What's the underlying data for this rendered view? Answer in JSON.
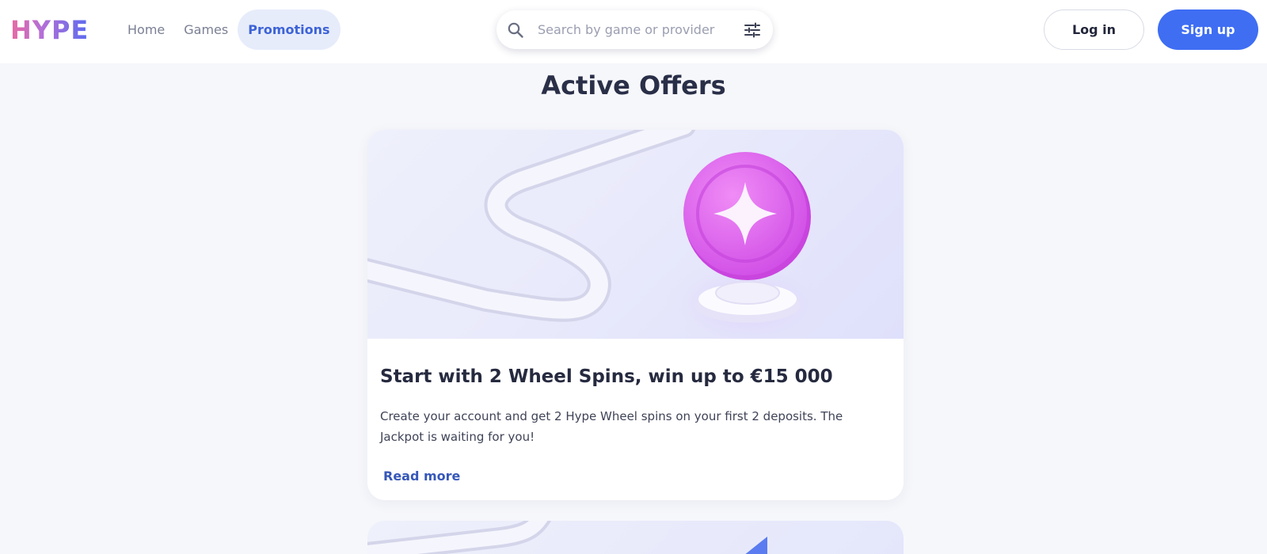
{
  "brand": {
    "logo_text": "HYPE"
  },
  "nav": {
    "items": [
      {
        "label": "Home",
        "active": false
      },
      {
        "label": "Games",
        "active": false
      },
      {
        "label": "Promotions",
        "active": true
      }
    ]
  },
  "search": {
    "placeholder": "Search by game or provider",
    "value": "",
    "icon": "search-icon",
    "filter_icon": "sliders-icon"
  },
  "auth": {
    "login_label": "Log in",
    "signup_label": "Sign up"
  },
  "colors": {
    "accent": "#3f6ef3",
    "nav_active_bg": "#e7ecfb",
    "nav_active_text": "#3d63d6",
    "coin": "#e05cf0"
  },
  "main": {
    "title": "Active Offers",
    "offers": [
      {
        "title": "Start with 2 Wheel Spins, win up to €15 000",
        "description": "Create your account and get 2 Hype Wheel spins on your first 2 deposits. The Jackpot is waiting for you!",
        "link_label": "Read more",
        "image_icon": "sparkle-coin-icon"
      }
    ]
  }
}
